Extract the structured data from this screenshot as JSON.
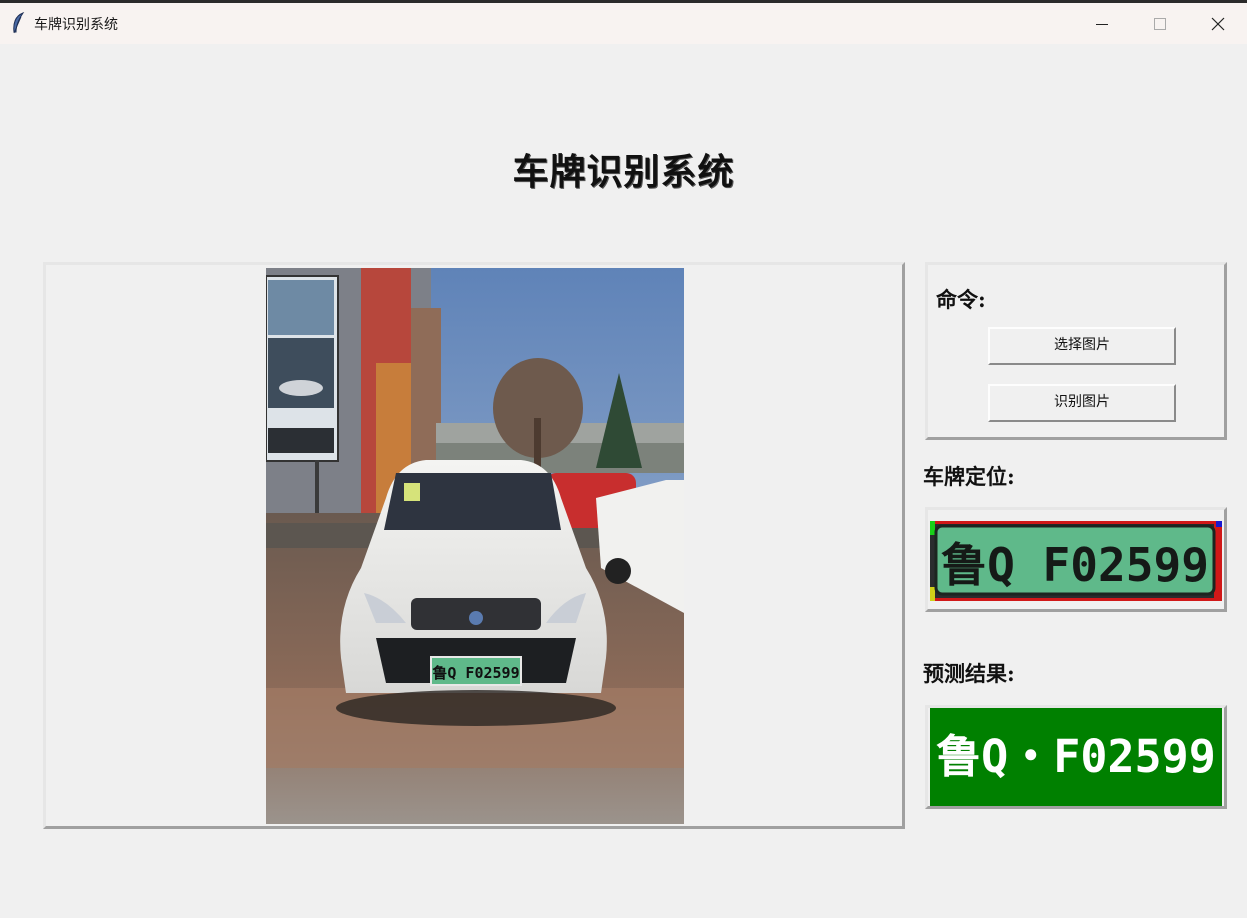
{
  "window": {
    "title": "车牌识别系统"
  },
  "heading": "车牌识别系统",
  "commands": {
    "label": "命令:",
    "select_image": "选择图片",
    "recognize_image": "识别图片"
  },
  "plate_location": {
    "label": "车牌定位:",
    "plate_text": "鲁Q F02599"
  },
  "prediction": {
    "label": "预测结果:",
    "result": "鲁Q・F02599"
  },
  "photo": {
    "plate_text": "鲁Q F02599"
  },
  "colors": {
    "result_background": "#008000",
    "plate_green": "#5fb98a"
  }
}
